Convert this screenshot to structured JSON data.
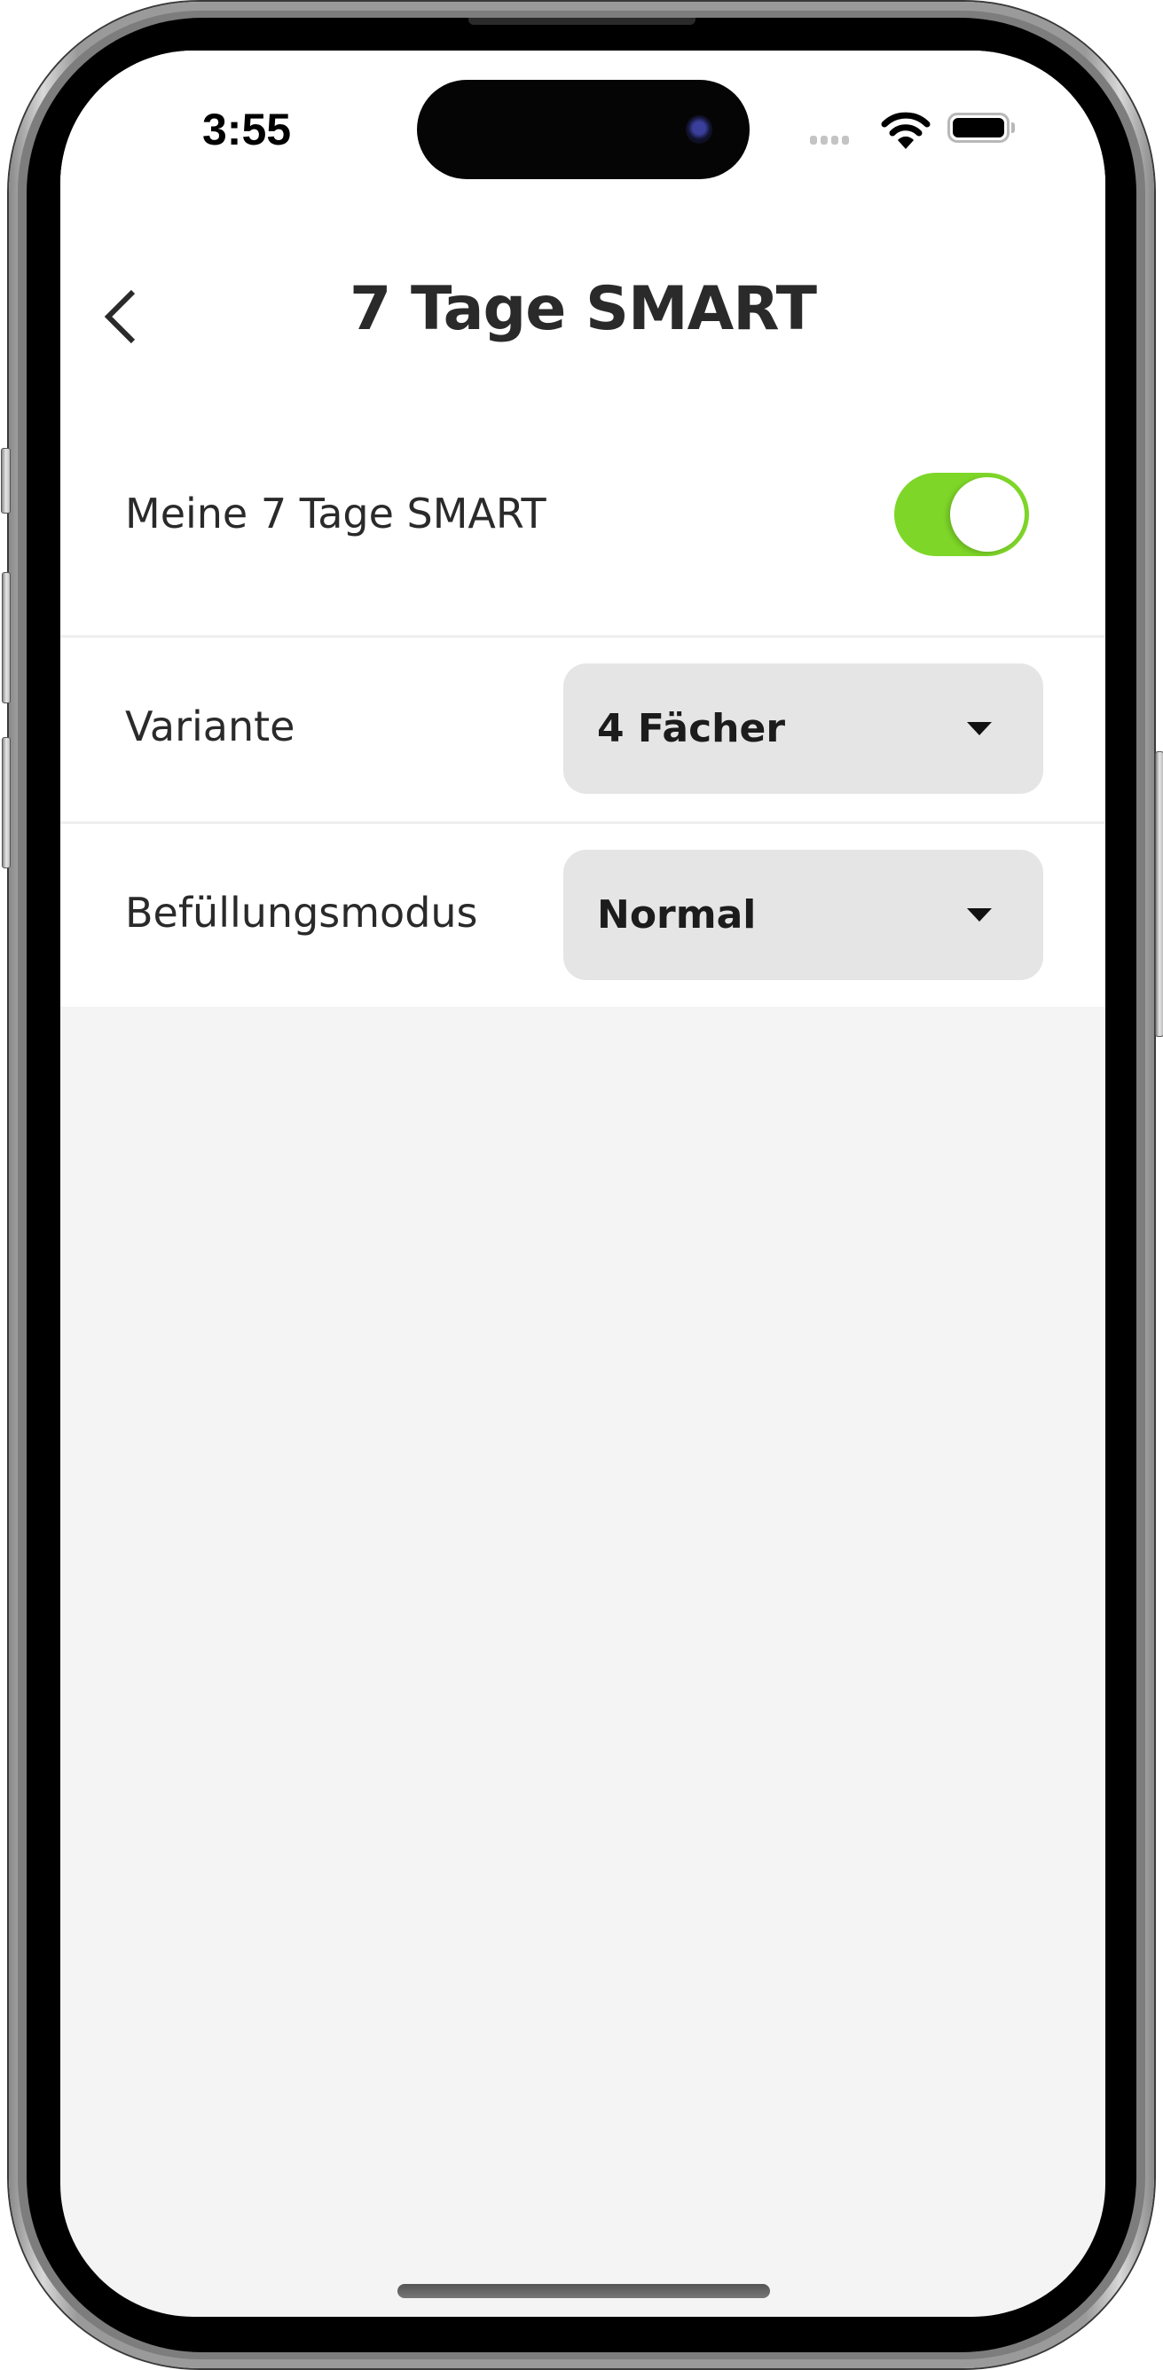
{
  "status_bar": {
    "time": "3:55",
    "icons": [
      "cellular-signal-icon",
      "wifi-icon",
      "battery-icon"
    ]
  },
  "header": {
    "back_icon": "chevron-left-icon",
    "title": "7 Tage SMART"
  },
  "settings": {
    "toggle_row": {
      "label": "Meine 7 Tage SMART",
      "enabled": true,
      "on_color": "#7ED628"
    },
    "variant_row": {
      "label": "Variante",
      "selected_value": "4 Fächer",
      "caret_icon": "caret-down-icon"
    },
    "fill_mode_row": {
      "label": "Befüllungsmodus",
      "selected_value": "Normal",
      "caret_icon": "caret-down-icon"
    }
  },
  "colors": {
    "accent_green": "#7ED628",
    "dropdown_bg": "#E5E5E5",
    "page_bg": "#F4F4F4",
    "text_primary": "#2A2A2A"
  }
}
